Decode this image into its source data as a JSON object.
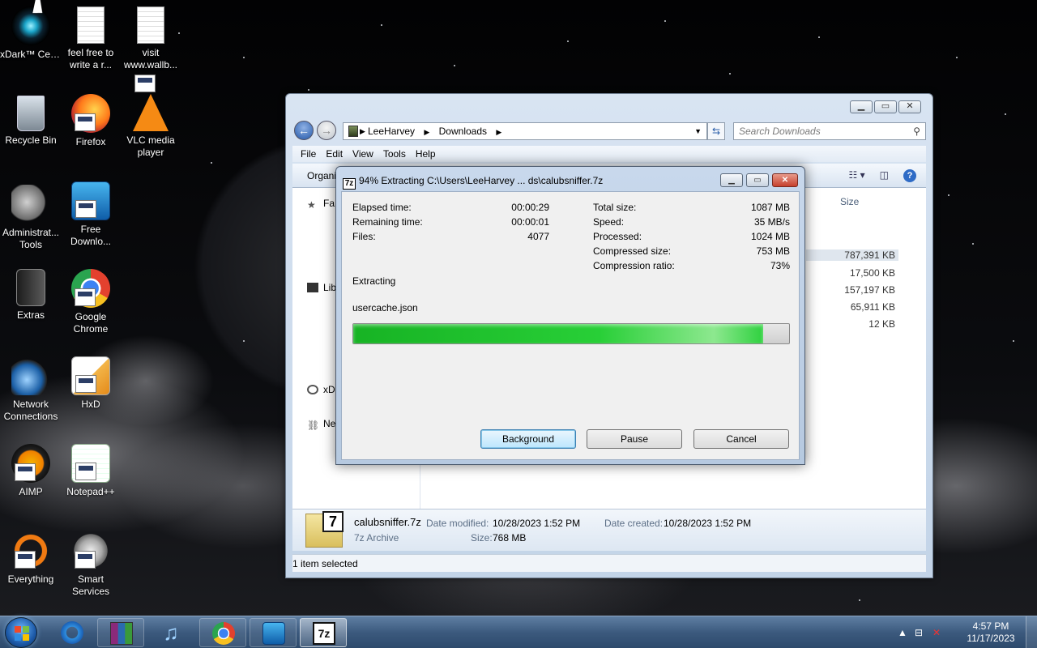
{
  "desktop": {
    "icons": [
      {
        "label": "xDark™ Center",
        "icon": "xdark-icon"
      },
      {
        "label": "feel free to write a r...",
        "icon": "text-file-icon"
      },
      {
        "label": "visit www.wallb...",
        "icon": "text-file-icon"
      },
      {
        "label": "Recycle Bin",
        "icon": "recycle-bin-icon"
      },
      {
        "label": "Firefox",
        "icon": "firefox-icon"
      },
      {
        "label": "VLC media player",
        "icon": "vlc-icon"
      },
      {
        "label": "Administrat... Tools",
        "icon": "admin-tools-icon"
      },
      {
        "label": "Free Downlo...",
        "icon": "free-download-manager-icon"
      },
      {
        "label": "Extras",
        "icon": "folder-icon"
      },
      {
        "label": "Google Chrome",
        "icon": "chrome-icon"
      },
      {
        "label": "Network Connections",
        "icon": "network-icon"
      },
      {
        "label": "HxD",
        "icon": "hxd-icon"
      },
      {
        "label": "AIMP",
        "icon": "aimp-icon"
      },
      {
        "label": "Notepad++",
        "icon": "notepad-plus-plus-icon"
      },
      {
        "label": "Everything",
        "icon": "everything-icon"
      },
      {
        "label": "Smart Services",
        "icon": "smart-services-icon"
      }
    ]
  },
  "explorer": {
    "breadcrumb": [
      "LeeHarvey",
      "Downloads"
    ],
    "search_placeholder": "Search Downloads",
    "menu": [
      "File",
      "Edit",
      "View",
      "Tools",
      "Help"
    ],
    "organize": "Organi",
    "size_header": "Size",
    "sizes": [
      "787,391 KB",
      "17,500 KB",
      "157,197 KB",
      "65,911 KB",
      "12 KB"
    ],
    "nav": [
      "Fa",
      "Lib",
      "xD",
      "Ne"
    ],
    "details": {
      "name": "calubsniffer.7z",
      "type": "7z Archive",
      "modified_label": "Date modified:",
      "modified": "10/28/2023 1:52 PM",
      "created_label": "Date created:",
      "created": "10/28/2023 1:52 PM",
      "size_label": "Size:",
      "size": "768 MB"
    },
    "status": "1 item selected"
  },
  "dialog": {
    "title": "94% Extracting C:\\Users\\LeeHarvey ... ds\\calubsniffer.7z",
    "elapsed_label": "Elapsed time:",
    "elapsed": "00:00:29",
    "remaining_label": "Remaining time:",
    "remaining": "00:00:01",
    "files_label": "Files:",
    "files": "4077",
    "total_label": "Total size:",
    "total": "1087 MB",
    "speed_label": "Speed:",
    "speed": "35 MB/s",
    "processed_label": "Processed:",
    "processed": "1024 MB",
    "compressed_label": "Compressed size:",
    "compressed": "753 MB",
    "ratio_label": "Compression ratio:",
    "ratio": "73%",
    "operation": "Extracting",
    "current_file": "usercache.json",
    "progress_fraction": 0.94,
    "buttons": {
      "background": "Background",
      "pause": "Pause",
      "cancel": "Cancel"
    }
  },
  "taskbar": {
    "apps": [
      "internet-explorer-icon",
      "winrar-icon",
      "itunes-icon",
      "chrome-icon",
      "free-download-manager-icon",
      "7zip-icon"
    ],
    "time": "4:57 PM",
    "date": "11/17/2023"
  },
  "colors": {
    "progress_green": "#28cf37",
    "default_button": "#bde6fd",
    "close_red": "#c6402d"
  }
}
